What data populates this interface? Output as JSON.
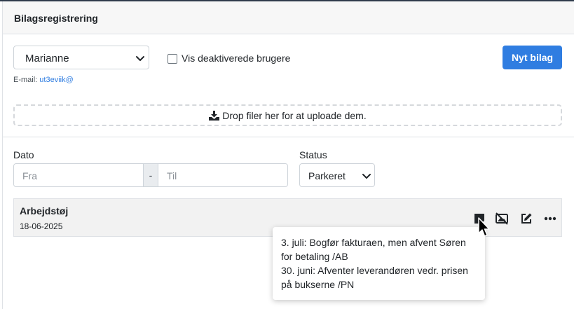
{
  "header": {
    "title": "Bilagsregistrering"
  },
  "user_select": {
    "value": "Marianne"
  },
  "show_inactive": {
    "label": "Vis deaktiverede brugere",
    "checked": false
  },
  "new_button": {
    "label": "Nyt bilag"
  },
  "email": {
    "label": "E-mail:",
    "value": "ut3eviik@"
  },
  "dropzone": {
    "text": "Drop filer her for at uploade dem."
  },
  "filters": {
    "date_label": "Dato",
    "from_placeholder": "Fra",
    "separator": "-",
    "to_placeholder": "Til",
    "status_label": "Status",
    "status_value": "Parkeret"
  },
  "rows": [
    {
      "title": "Arbejdstøj",
      "date": "18-06-2025"
    }
  ],
  "tooltip": {
    "lines": [
      "3. juli: Bogfør fakturaen, men afvent Søren",
      "for betaling /AB",
      "30. juni: Afventer leverandøren vedr. prisen",
      "på bukserne /PN"
    ]
  },
  "colors": {
    "accent": "#2f7de1",
    "header_bg": "#f7f7f7",
    "row_bg": "#f2f2f2"
  },
  "icons": [
    "chevron-down-icon",
    "download-icon",
    "note-icon",
    "hide-image-icon",
    "edit-icon",
    "more-icon",
    "cursor-icon"
  ]
}
